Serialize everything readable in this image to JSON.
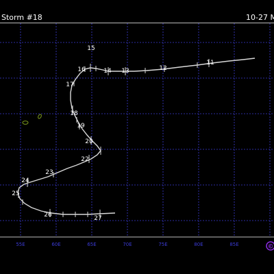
{
  "header": {
    "title": "Storm #18",
    "date": "10-27 M"
  },
  "map": {
    "longitude_labels": [
      "55E",
      "60E",
      "65E",
      "70E",
      "75E",
      "80E",
      "85E"
    ],
    "colors": {
      "grid": "#3b3bd6",
      "track": "#d9d9d9",
      "label": "#ffffff",
      "axis_label": "#3b3bd6",
      "island": "#7f9d1f",
      "logo": "#8a2be2"
    },
    "track_labels": [
      "11",
      "12",
      "13",
      "14",
      "15",
      "16",
      "17",
      "18",
      "19",
      "20",
      "22",
      "23",
      "24",
      "25",
      "26",
      "27"
    ],
    "logo_icon": "copyright-icon"
  }
}
